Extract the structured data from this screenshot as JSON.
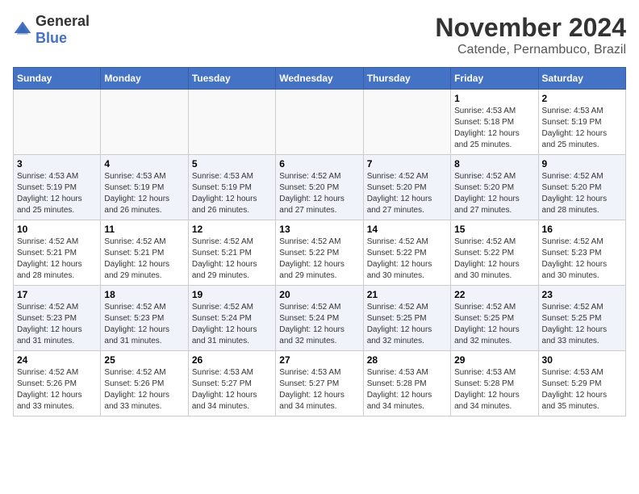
{
  "logo": {
    "text_general": "General",
    "text_blue": "Blue"
  },
  "title": {
    "month_year": "November 2024",
    "location": "Catende, Pernambuco, Brazil"
  },
  "weekdays": [
    "Sunday",
    "Monday",
    "Tuesday",
    "Wednesday",
    "Thursday",
    "Friday",
    "Saturday"
  ],
  "weeks": [
    [
      {
        "day": "",
        "info": ""
      },
      {
        "day": "",
        "info": ""
      },
      {
        "day": "",
        "info": ""
      },
      {
        "day": "",
        "info": ""
      },
      {
        "day": "",
        "info": ""
      },
      {
        "day": "1",
        "info": "Sunrise: 4:53 AM\nSunset: 5:18 PM\nDaylight: 12 hours and 25 minutes."
      },
      {
        "day": "2",
        "info": "Sunrise: 4:53 AM\nSunset: 5:19 PM\nDaylight: 12 hours and 25 minutes."
      }
    ],
    [
      {
        "day": "3",
        "info": "Sunrise: 4:53 AM\nSunset: 5:19 PM\nDaylight: 12 hours and 25 minutes."
      },
      {
        "day": "4",
        "info": "Sunrise: 4:53 AM\nSunset: 5:19 PM\nDaylight: 12 hours and 26 minutes."
      },
      {
        "day": "5",
        "info": "Sunrise: 4:53 AM\nSunset: 5:19 PM\nDaylight: 12 hours and 26 minutes."
      },
      {
        "day": "6",
        "info": "Sunrise: 4:52 AM\nSunset: 5:20 PM\nDaylight: 12 hours and 27 minutes."
      },
      {
        "day": "7",
        "info": "Sunrise: 4:52 AM\nSunset: 5:20 PM\nDaylight: 12 hours and 27 minutes."
      },
      {
        "day": "8",
        "info": "Sunrise: 4:52 AM\nSunset: 5:20 PM\nDaylight: 12 hours and 27 minutes."
      },
      {
        "day": "9",
        "info": "Sunrise: 4:52 AM\nSunset: 5:20 PM\nDaylight: 12 hours and 28 minutes."
      }
    ],
    [
      {
        "day": "10",
        "info": "Sunrise: 4:52 AM\nSunset: 5:21 PM\nDaylight: 12 hours and 28 minutes."
      },
      {
        "day": "11",
        "info": "Sunrise: 4:52 AM\nSunset: 5:21 PM\nDaylight: 12 hours and 29 minutes."
      },
      {
        "day": "12",
        "info": "Sunrise: 4:52 AM\nSunset: 5:21 PM\nDaylight: 12 hours and 29 minutes."
      },
      {
        "day": "13",
        "info": "Sunrise: 4:52 AM\nSunset: 5:22 PM\nDaylight: 12 hours and 29 minutes."
      },
      {
        "day": "14",
        "info": "Sunrise: 4:52 AM\nSunset: 5:22 PM\nDaylight: 12 hours and 30 minutes."
      },
      {
        "day": "15",
        "info": "Sunrise: 4:52 AM\nSunset: 5:22 PM\nDaylight: 12 hours and 30 minutes."
      },
      {
        "day": "16",
        "info": "Sunrise: 4:52 AM\nSunset: 5:23 PM\nDaylight: 12 hours and 30 minutes."
      }
    ],
    [
      {
        "day": "17",
        "info": "Sunrise: 4:52 AM\nSunset: 5:23 PM\nDaylight: 12 hours and 31 minutes."
      },
      {
        "day": "18",
        "info": "Sunrise: 4:52 AM\nSunset: 5:23 PM\nDaylight: 12 hours and 31 minutes."
      },
      {
        "day": "19",
        "info": "Sunrise: 4:52 AM\nSunset: 5:24 PM\nDaylight: 12 hours and 31 minutes."
      },
      {
        "day": "20",
        "info": "Sunrise: 4:52 AM\nSunset: 5:24 PM\nDaylight: 12 hours and 32 minutes."
      },
      {
        "day": "21",
        "info": "Sunrise: 4:52 AM\nSunset: 5:25 PM\nDaylight: 12 hours and 32 minutes."
      },
      {
        "day": "22",
        "info": "Sunrise: 4:52 AM\nSunset: 5:25 PM\nDaylight: 12 hours and 32 minutes."
      },
      {
        "day": "23",
        "info": "Sunrise: 4:52 AM\nSunset: 5:25 PM\nDaylight: 12 hours and 33 minutes."
      }
    ],
    [
      {
        "day": "24",
        "info": "Sunrise: 4:52 AM\nSunset: 5:26 PM\nDaylight: 12 hours and 33 minutes."
      },
      {
        "day": "25",
        "info": "Sunrise: 4:52 AM\nSunset: 5:26 PM\nDaylight: 12 hours and 33 minutes."
      },
      {
        "day": "26",
        "info": "Sunrise: 4:53 AM\nSunset: 5:27 PM\nDaylight: 12 hours and 34 minutes."
      },
      {
        "day": "27",
        "info": "Sunrise: 4:53 AM\nSunset: 5:27 PM\nDaylight: 12 hours and 34 minutes."
      },
      {
        "day": "28",
        "info": "Sunrise: 4:53 AM\nSunset: 5:28 PM\nDaylight: 12 hours and 34 minutes."
      },
      {
        "day": "29",
        "info": "Sunrise: 4:53 AM\nSunset: 5:28 PM\nDaylight: 12 hours and 34 minutes."
      },
      {
        "day": "30",
        "info": "Sunrise: 4:53 AM\nSunset: 5:29 PM\nDaylight: 12 hours and 35 minutes."
      }
    ]
  ]
}
